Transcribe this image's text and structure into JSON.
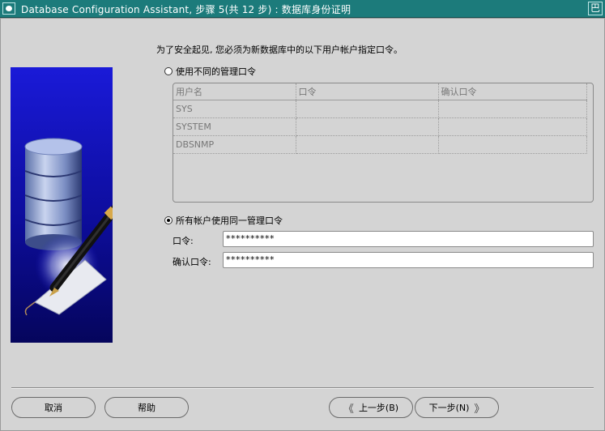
{
  "window": {
    "title": "Database Configuration Assistant, 步骤 5(共 12 步) : 数据库身份证明",
    "max_glyph": "巴"
  },
  "main": {
    "instruction": "为了安全起见, 您必须为新数据库中的以下用户帐户指定口令。",
    "option_different": "使用不同的管理口令",
    "option_same": "所有帐户使用同一管理口令",
    "selected_option": "same"
  },
  "table": {
    "columns": [
      "用户名",
      "口令",
      "确认口令"
    ],
    "rows": [
      [
        "SYS",
        "",
        ""
      ],
      [
        "SYSTEM",
        "",
        ""
      ],
      [
        "DBSNMP",
        "",
        ""
      ]
    ]
  },
  "fields": {
    "password_label": "口令:",
    "password_value": "**********",
    "confirm_label": "确认口令:",
    "confirm_value": "**********"
  },
  "buttons": {
    "cancel": "取消",
    "help": "帮助",
    "back": "上一步(B)",
    "next": "下一步(N)",
    "back_chev": "《",
    "next_chev": "》"
  }
}
